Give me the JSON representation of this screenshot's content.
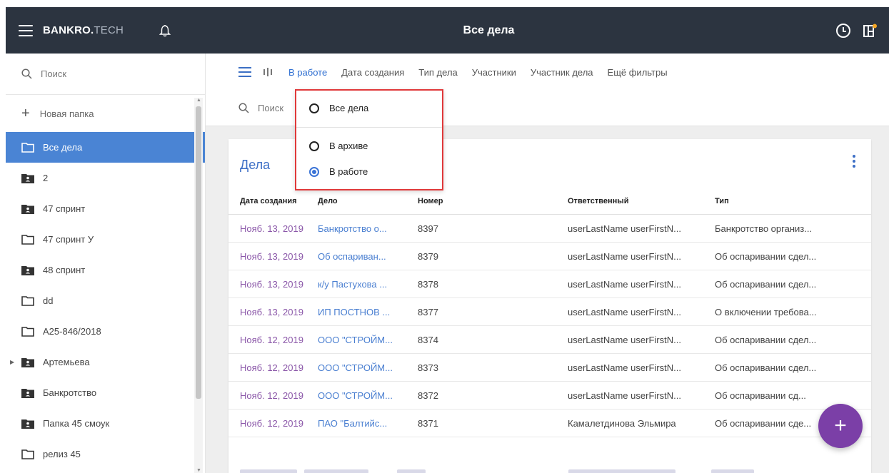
{
  "header": {
    "brand_bold": "BANKRO.",
    "brand_thin": "TECH",
    "title": "Все дела",
    "icons": [
      "menu-icon",
      "bell-icon",
      "clock-icon",
      "layout-icon"
    ]
  },
  "sidebar": {
    "search_placeholder": "Поиск",
    "new_folder": "Новая папка",
    "items": [
      {
        "label": "Все дела",
        "icon": "folder-outline-icon",
        "active": true
      },
      {
        "label": "2",
        "icon": "shared-folder-icon"
      },
      {
        "label": "47 спринт",
        "icon": "shared-folder-icon"
      },
      {
        "label": "47 спринт У",
        "icon": "folder-outline-icon"
      },
      {
        "label": "48 спринт",
        "icon": "shared-folder-icon"
      },
      {
        "label": "dd",
        "icon": "folder-outline-icon"
      },
      {
        "label": "А25-846/2018",
        "icon": "folder-outline-icon"
      },
      {
        "label": "Артемьева",
        "icon": "shared-folder-icon",
        "expandable": true
      },
      {
        "label": "Банкротство",
        "icon": "shared-folder-icon"
      },
      {
        "label": "Папка 45 смоук",
        "icon": "shared-folder-icon"
      },
      {
        "label": "релиз 45",
        "icon": "folder-outline-icon"
      }
    ]
  },
  "filters": {
    "tabs": [
      "В работе",
      "Дата создания",
      "Тип дела",
      "Участники",
      "Участник дела",
      "Ещё фильтры"
    ],
    "active_tab": "В работе",
    "search_placeholder": "Поиск"
  },
  "status_dropdown": {
    "options": [
      {
        "label": "Все дела",
        "checked": false
      },
      {
        "label": "В архиве",
        "checked": false
      },
      {
        "label": "В работе",
        "checked": true
      }
    ]
  },
  "card": {
    "title": "Дела",
    "columns": [
      "Дата создания",
      "Дело",
      "Номер",
      "Ответственный",
      "Тип"
    ],
    "rows": [
      [
        "Нояб. 13, 2019",
        "Банкротство о...",
        "8397",
        "userLastName userFirstN...",
        "Банкротство организ..."
      ],
      [
        "Нояб. 13, 2019",
        "Об оспариван...",
        "8379",
        "userLastName userFirstN...",
        "Об оспаривании сдел..."
      ],
      [
        "Нояб. 13, 2019",
        "к/у Пастухова ...",
        "8378",
        "userLastName userFirstN...",
        "Об оспаривании сдел..."
      ],
      [
        "Нояб. 13, 2019",
        "ИП ПОСТНОВ ...",
        "8377",
        "userLastName userFirstN...",
        "О включении требова..."
      ],
      [
        "Нояб. 12, 2019",
        "ООО \"СТРОЙМ...",
        "8374",
        "userLastName userFirstN...",
        "Об оспаривании сдел..."
      ],
      [
        "Нояб. 12, 2019",
        "ООО \"СТРОЙМ...",
        "8373",
        "userLastName userFirstN...",
        "Об оспаривании сдел..."
      ],
      [
        "Нояб. 12, 2019",
        "ООО \"СТРОЙМ...",
        "8372",
        "userLastName userFirstN...",
        "Об оспаривании сд..."
      ],
      [
        "Нояб. 12, 2019",
        "ПАО \"Балтийс...",
        "8371",
        "Камалетдинова Эльмира",
        "Об оспаривании сде..."
      ]
    ]
  },
  "fab_label": "+",
  "colors": {
    "topbar": "#2c3440",
    "accent_blue": "#4a84d4",
    "date_purple": "#8a56a8",
    "fab_purple": "#7b3fa7",
    "highlight_red": "#e0393a"
  }
}
